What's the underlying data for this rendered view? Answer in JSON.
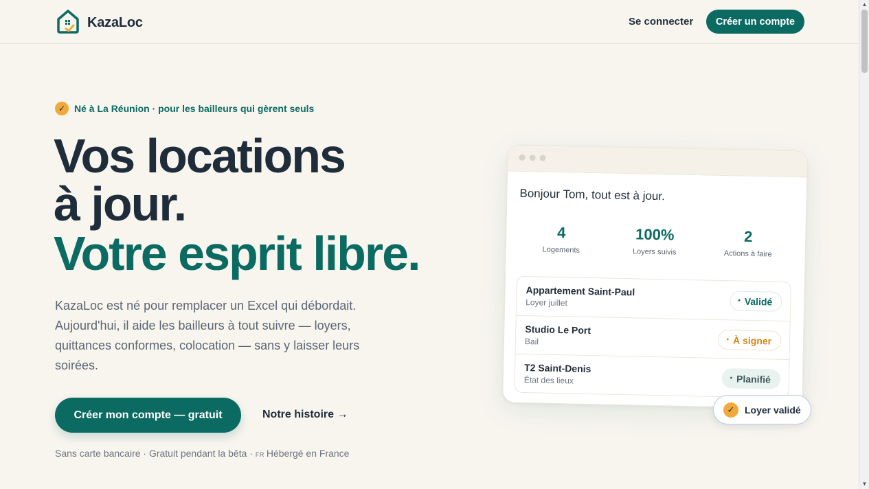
{
  "header": {
    "brand": "KazaLoc",
    "login_label": "Se connecter",
    "signup_label": "Créer un compte"
  },
  "hero": {
    "badge": "Né à La Réunion · pour les bailleurs qui gèrent seuls",
    "headline_line1": "Vos locations",
    "headline_line2": "à jour.",
    "headline_line3": "Votre esprit libre.",
    "intro": "KazaLoc est né pour remplacer un Excel qui débordait. Aujourd'hui, il aide les bailleurs à tout suivre — loyers, quittances conformes, colocation — sans y laisser leurs soirées.",
    "cta_label": "Créer mon compte — gratuit",
    "story_label": "Notre histoire →",
    "footnote_main": "Sans carte bancaire · Gratuit pendant la bêta · ",
    "footnote_flag": "FR",
    "footnote_end": "Hébergé en France"
  },
  "mockup": {
    "greeting": "Bonjour Tom, tout est à jour.",
    "stats": [
      {
        "value": "4",
        "label": "Logements"
      },
      {
        "value": "100%",
        "label": "Loyers suivis"
      },
      {
        "value": "2",
        "label": "Actions à faire"
      }
    ],
    "rows": [
      {
        "title": "Appartement Saint-Paul",
        "sub": "Loyer juillet",
        "status": "Validé"
      },
      {
        "title": "Studio Le Port",
        "sub": "Bail",
        "status": "À signer"
      },
      {
        "title": "T2 Saint-Denis",
        "sub": "État des lieux",
        "status": "Planifié"
      }
    ],
    "toast": "Loyer validé"
  },
  "colors": {
    "accent": "#0b6b62",
    "background": "#f8f5ef",
    "highlight": "#f0a93a",
    "warning": "#d98414"
  },
  "icons": {
    "logo": "house-check-icon",
    "badge": "check-icon",
    "toast": "check-icon"
  }
}
